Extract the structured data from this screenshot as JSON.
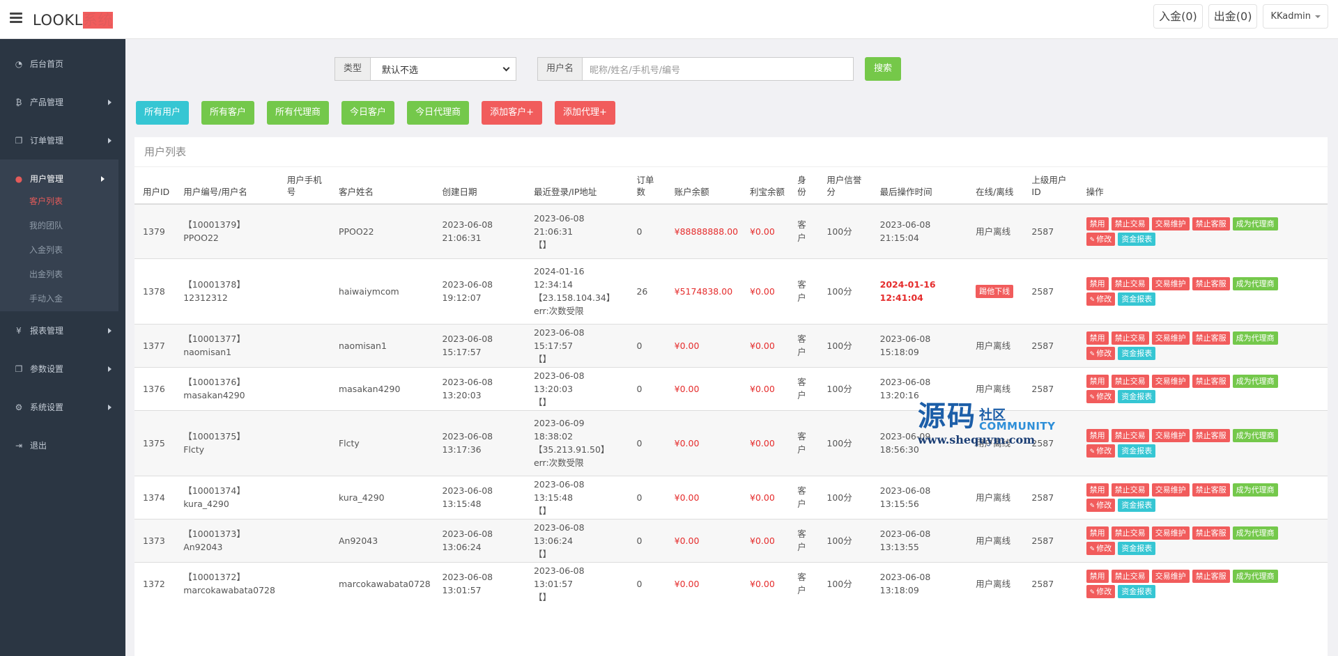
{
  "app": {
    "logo_main": "LOOKL",
    "logo_accent": "系统"
  },
  "topbar": {
    "deposit": "入金(0)",
    "withdraw": "出金(0)",
    "admin": "KKadmin"
  },
  "sidebar": {
    "items": [
      {
        "icon": "dashboard-icon",
        "label": "后台首页"
      },
      {
        "icon": "bitcoin-icon",
        "label": "产品管理"
      },
      {
        "icon": "copy-icon",
        "label": "订单管理"
      },
      {
        "icon": "user-icon",
        "label": "用户管理"
      },
      {
        "icon": "yen-icon",
        "label": "报表管理"
      },
      {
        "icon": "copy-icon",
        "label": "参数设置"
      },
      {
        "icon": "cogs-icon",
        "label": "系统设置"
      },
      {
        "icon": "logout-icon",
        "label": "退出"
      }
    ],
    "user_sub": [
      "客户列表",
      "我的团队",
      "入金列表",
      "出金列表",
      "手动入金"
    ]
  },
  "filters": {
    "type_label": "类型",
    "type_value": "默认不选",
    "user_label": "用户名",
    "user_placeholder": "昵称/姓名/手机号/编号",
    "search": "搜索"
  },
  "actions": [
    "所有用户",
    "所有客户",
    "所有代理商",
    "今日客户",
    "今日代理商",
    "添加客户+",
    "添加代理+"
  ],
  "panel_title": "用户列表",
  "columns": [
    "用户ID",
    "用户编号/用户名",
    "用户手机号",
    "客户姓名",
    "创建日期",
    "最近登录/IP地址",
    "订单数",
    "账户余额",
    "利宝余额",
    "身份",
    "用户信誉分",
    "最后操作时间",
    "在线/离线",
    "上级用户ID",
    "操作"
  ],
  "op_buttons": {
    "ban": "禁用",
    "ban_trade": "禁止交易",
    "trade_maint": "交易维护",
    "ban_service": "禁止客服",
    "agent": "成为代理商",
    "edit": "修改",
    "fund_report": "资金报表"
  },
  "rows": [
    {
      "id": "1379",
      "code": "【10001379】",
      "username": "PPOO22",
      "phone": "",
      "name": "PPOO22",
      "created": "2023-06-08 21:06:31",
      "login_time": "2023-06-08 21:06:31",
      "ip": "【】",
      "err": "",
      "orders": "0",
      "balance": "¥88888888.00",
      "libao": "¥0.00",
      "role": "客户",
      "credit": "100分",
      "last_op": "2023-06-08 21:15:04",
      "status": "用户离线",
      "parent": "2587"
    },
    {
      "id": "1378",
      "code": "【10001378】",
      "username": "12312312",
      "phone": "",
      "name": "haiwaiymcom",
      "created": "2023-06-08 19:12:07",
      "login_time": "2024-01-16 12:34:14",
      "ip": "【23.158.104.34】",
      "err": "err:次数受限",
      "orders": "26",
      "balance": "¥5174838.00",
      "libao": "¥0.00",
      "role": "客户",
      "credit": "100分",
      "last_op": "2024-01-16 12:41:04",
      "status": "踢他下线",
      "parent": "2587"
    },
    {
      "id": "1377",
      "code": "【10001377】",
      "username": "naomisan1",
      "phone": "",
      "name": "naomisan1",
      "created": "2023-06-08 15:17:57",
      "login_time": "2023-06-08 15:17:57",
      "ip": "【】",
      "err": "",
      "orders": "0",
      "balance": "¥0.00",
      "libao": "¥0.00",
      "role": "客户",
      "credit": "100分",
      "last_op": "2023-06-08 15:18:09",
      "status": "用户离线",
      "parent": "2587"
    },
    {
      "id": "1376",
      "code": "【10001376】",
      "username": "masakan4290",
      "phone": "",
      "name": "masakan4290",
      "created": "2023-06-08 13:20:03",
      "login_time": "2023-06-08 13:20:03",
      "ip": "【】",
      "err": "",
      "orders": "0",
      "balance": "¥0.00",
      "libao": "¥0.00",
      "role": "客户",
      "credit": "100分",
      "last_op": "2023-06-08 13:20:16",
      "status": "用户离线",
      "parent": "2587"
    },
    {
      "id": "1375",
      "code": "【10001375】",
      "username": "Flcty",
      "phone": "",
      "name": "Flcty",
      "created": "2023-06-08 13:17:36",
      "login_time": "2023-06-09 18:38:02",
      "ip": "【35.213.91.50】",
      "err": "err:次数受限",
      "orders": "0",
      "balance": "¥0.00",
      "libao": "¥0.00",
      "role": "客户",
      "credit": "100分",
      "last_op": "2023-06-09 18:56:30",
      "status": "用户离线",
      "parent": "2587"
    },
    {
      "id": "1374",
      "code": "【10001374】",
      "username": "kura_4290",
      "phone": "",
      "name": "kura_4290",
      "created": "2023-06-08 13:15:48",
      "login_time": "2023-06-08 13:15:48",
      "ip": "【】",
      "err": "",
      "orders": "0",
      "balance": "¥0.00",
      "libao": "¥0.00",
      "role": "客户",
      "credit": "100分",
      "last_op": "2023-06-08 13:15:56",
      "status": "用户离线",
      "parent": "2587"
    },
    {
      "id": "1373",
      "code": "【10001373】",
      "username": "An92043",
      "phone": "",
      "name": "An92043",
      "created": "2023-06-08 13:06:24",
      "login_time": "2023-06-08 13:06:24",
      "ip": "【】",
      "err": "",
      "orders": "0",
      "balance": "¥0.00",
      "libao": "¥0.00",
      "role": "客户",
      "credit": "100分",
      "last_op": "2023-06-08 13:13:55",
      "status": "用户离线",
      "parent": "2587"
    },
    {
      "id": "1372",
      "code": "【10001372】",
      "username": "marcokawabata0728",
      "phone": "",
      "name": "marcokawabata0728",
      "created": "2023-06-08 13:01:57",
      "login_time": "2023-06-08 13:01:57",
      "ip": "【】",
      "err": "",
      "orders": "0",
      "balance": "¥0.00",
      "libao": "¥0.00",
      "role": "客户",
      "credit": "100分",
      "last_op": "2023-06-08 13:18:09",
      "status": "用户离线",
      "parent": "2587"
    }
  ],
  "watermark": {
    "big": "源码",
    "small": "社区",
    "community": "COMMUNITY",
    "url": "www.shequym.com"
  },
  "colors": {
    "sidebar": "#2b3643",
    "accent_red": "#e35b5a",
    "teal": "#36c6d3",
    "green": "#74c84b",
    "danger": "#f15c5c"
  }
}
